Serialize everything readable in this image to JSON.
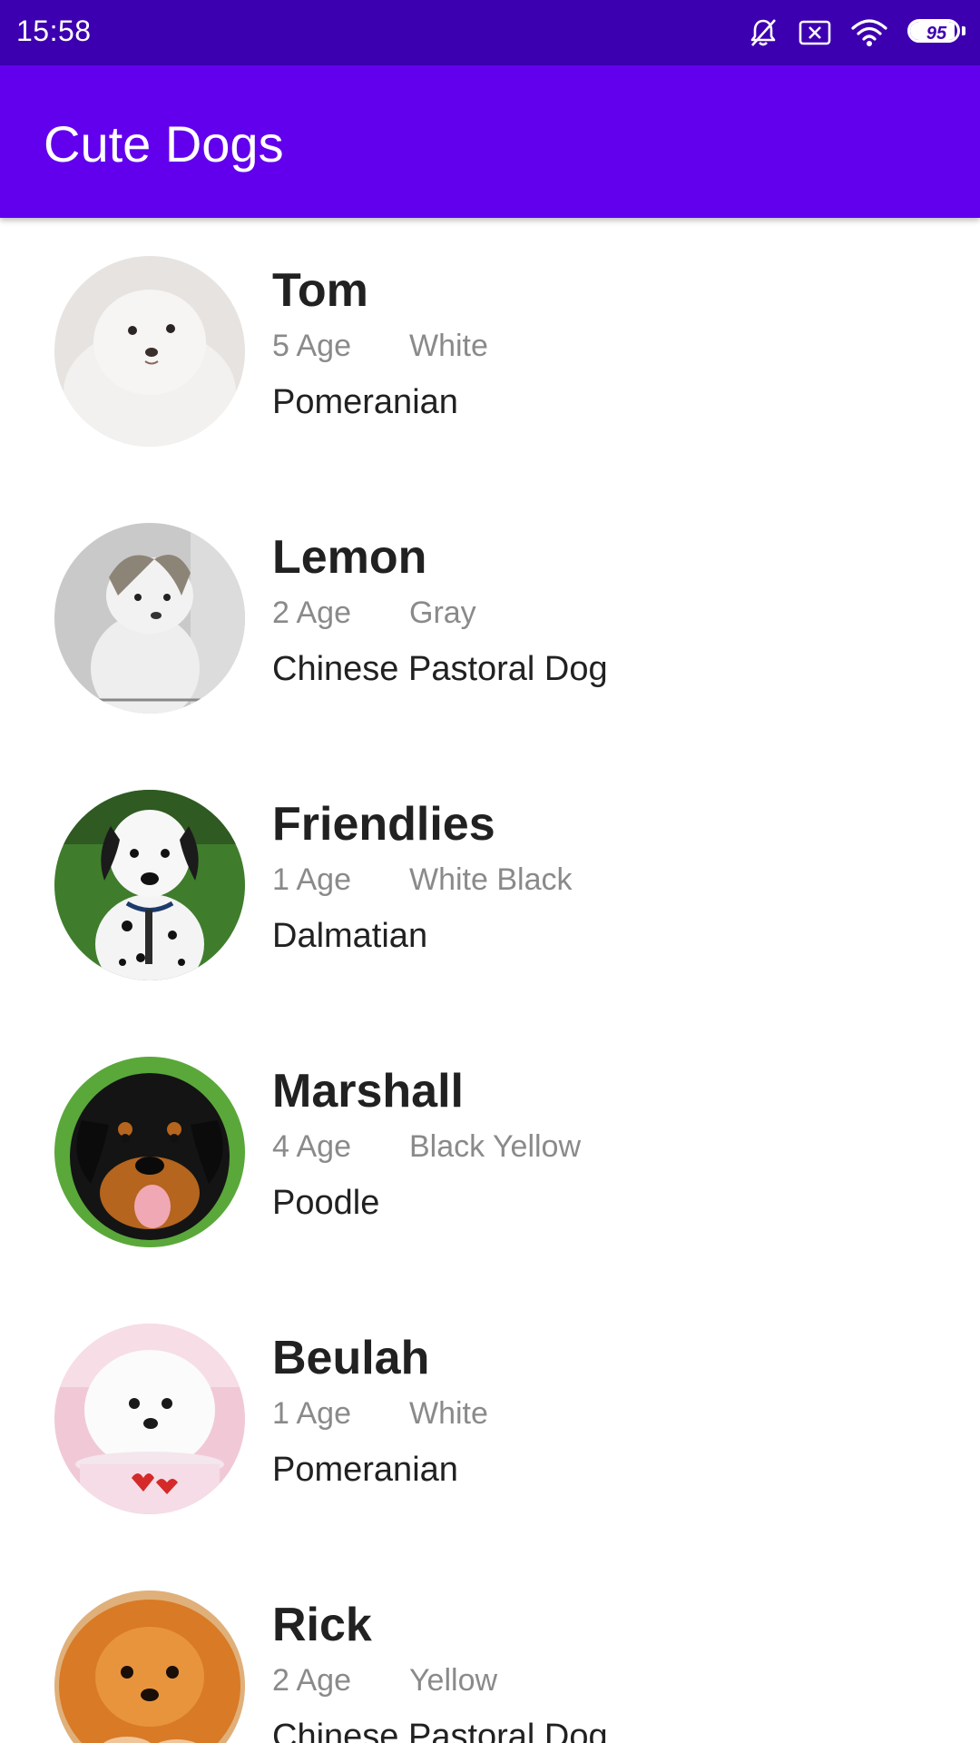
{
  "status_bar": {
    "time": "15:58",
    "icons": [
      "bell-off-icon",
      "sim-blocked-icon",
      "wifi-icon",
      "battery-icon"
    ],
    "battery_level": "95",
    "battery_fraction": 0.95,
    "color": "#3d00b0"
  },
  "app_bar": {
    "title": "Cute Dogs",
    "color": "#6200ee"
  },
  "dogs": [
    {
      "name": "Tom",
      "age": "5 Age",
      "color": "White",
      "breed": "Pomeranian"
    },
    {
      "name": "Lemon",
      "age": "2 Age",
      "color": "Gray",
      "breed": "Chinese Pastoral Dog"
    },
    {
      "name": "Friendlies",
      "age": "1 Age",
      "color": "White Black",
      "breed": "Dalmatian"
    },
    {
      "name": "Marshall",
      "age": "4 Age",
      "color": "Black Yellow",
      "breed": "Poodle"
    },
    {
      "name": "Beulah",
      "age": "1 Age",
      "color": "White",
      "breed": "Pomeranian"
    },
    {
      "name": "Rick",
      "age": "2 Age",
      "color": "Yellow",
      "breed": "Chinese Pastoral Dog"
    }
  ]
}
